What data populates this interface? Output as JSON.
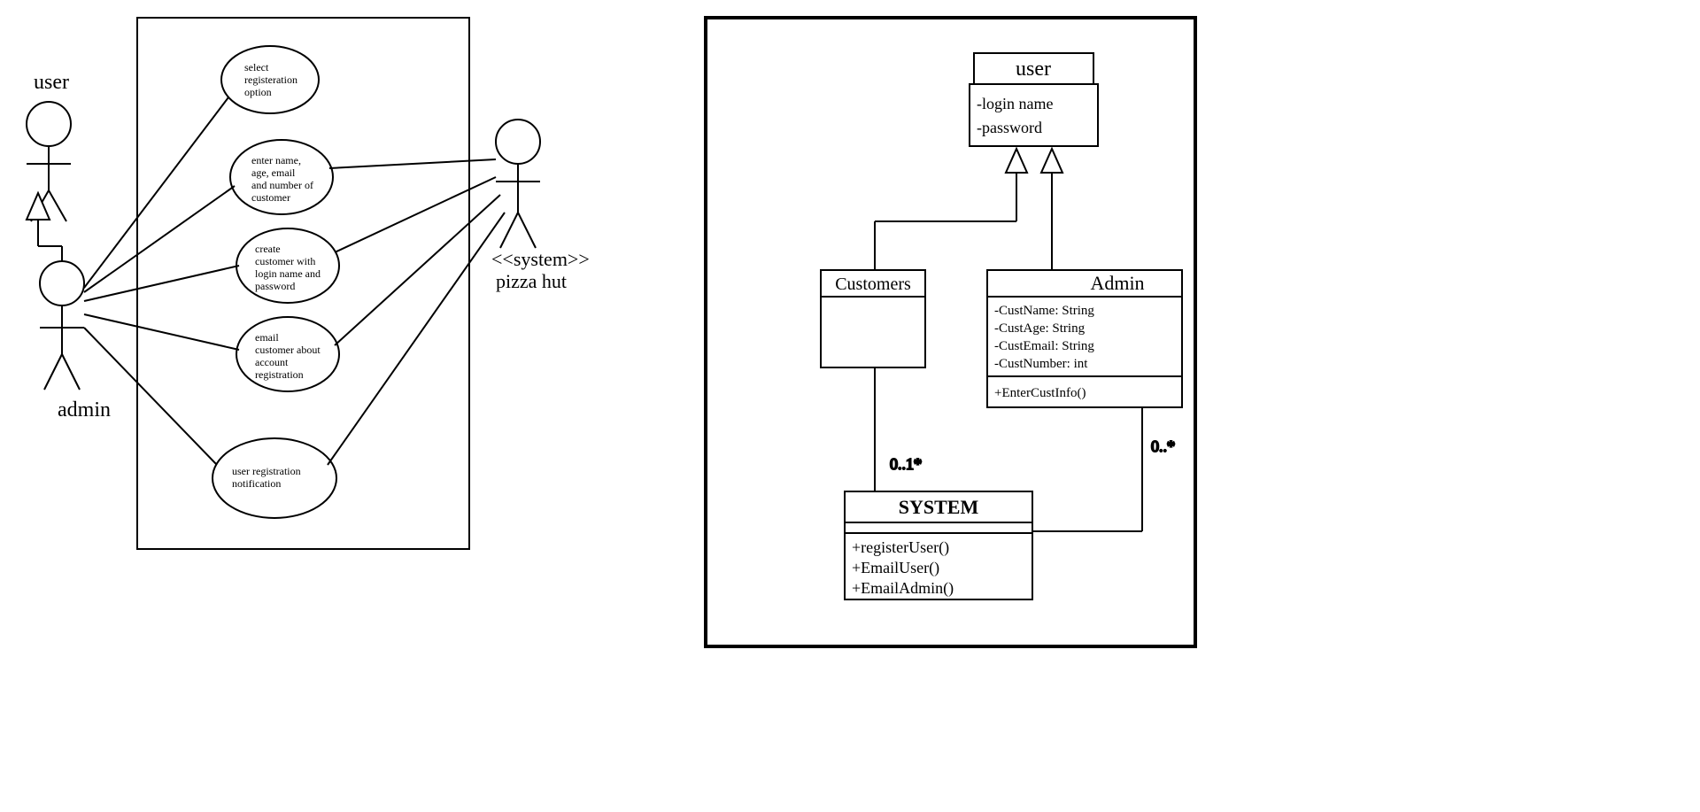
{
  "usecase": {
    "actors": {
      "user": "user",
      "admin": "admin",
      "system_stereo": "<<system>>",
      "system_name": "pizza hut"
    },
    "cases": {
      "uc1_l1": "select",
      "uc1_l2": "registeration",
      "uc1_l3": "option",
      "uc2_l1": "enter name,",
      "uc2_l2": "age, email",
      "uc2_l3": "and number of",
      "uc2_l4": "customer",
      "uc3_l1": "create",
      "uc3_l2": "customer with",
      "uc3_l3": "login name and",
      "uc3_l4": "password",
      "uc4_l1": "email",
      "uc4_l2": "customer about",
      "uc4_l3": "account",
      "uc4_l4": "registration",
      "uc5_l1": "user registration",
      "uc5_l2": "notification"
    }
  },
  "classdiag": {
    "user": {
      "name": "user",
      "a1": "-login name",
      "a2": "-password"
    },
    "customers": {
      "name": "Customers"
    },
    "admin": {
      "name": "Admin",
      "a1": "-CustName: String",
      "a2": "-CustAge: String",
      "a3": "-CustEmail: String",
      "a4": "-CustNumber: int",
      "m1": "+EnterCustInfo()"
    },
    "system": {
      "name": "SYSTEM",
      "m1": "+registerUser()",
      "m2": "+EmailUser()",
      "m3": "+EmailAdmin()"
    },
    "mult": {
      "left": "0..1*",
      "right": "0..*"
    }
  }
}
